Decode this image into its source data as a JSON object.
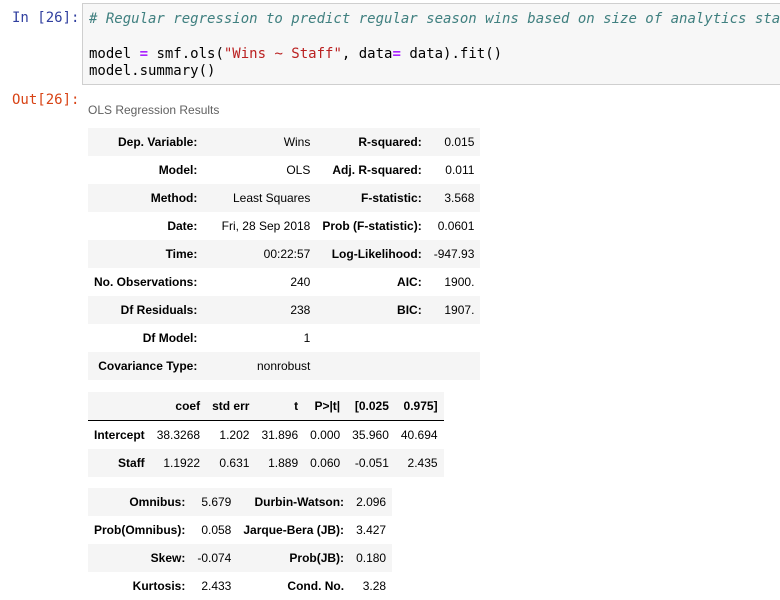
{
  "input_prompt": "In [26]:",
  "output_prompt": "Out[26]:",
  "code": {
    "line1": "# Regular regression to predict regular season wins based on size of analytics staff",
    "line2": [
      "model ",
      "=",
      " smf.ols(",
      "\"Wins ~ Staff\"",
      ", data",
      "=",
      " data).fit()"
    ],
    "line3": "model.summary()"
  },
  "caption": "OLS Regression Results",
  "summary_top": [
    [
      "Dep. Variable:",
      "Wins",
      "R-squared:",
      "0.015"
    ],
    [
      "Model:",
      "OLS",
      "Adj. R-squared:",
      "0.011"
    ],
    [
      "Method:",
      "Least Squares",
      "F-statistic:",
      "3.568"
    ],
    [
      "Date:",
      "Fri, 28 Sep 2018",
      "Prob (F-statistic):",
      "0.0601"
    ],
    [
      "Time:",
      "00:22:57",
      "Log-Likelihood:",
      "-947.93"
    ],
    [
      "No. Observations:",
      "240",
      "AIC:",
      "1900."
    ],
    [
      "Df Residuals:",
      "238",
      "BIC:",
      "1907."
    ],
    [
      "Df Model:",
      "1",
      "",
      ""
    ],
    [
      "Covariance Type:",
      "nonrobust",
      "",
      ""
    ]
  ],
  "coef_table": {
    "headers": [
      "",
      "coef",
      "std err",
      "t",
      "P>|t|",
      "[0.025",
      "0.975]"
    ],
    "rows": [
      [
        "Intercept",
        "38.3268",
        "1.202",
        "31.896",
        "0.000",
        "35.960",
        "40.694"
      ],
      [
        "Staff",
        "1.1922",
        "0.631",
        "1.889",
        "0.060",
        "-0.051",
        "2.435"
      ]
    ]
  },
  "diagnostics": [
    [
      "Omnibus:",
      "5.679",
      "Durbin-Watson:",
      "2.096"
    ],
    [
      "Prob(Omnibus):",
      "0.058",
      "Jarque-Bera (JB):",
      "3.427"
    ],
    [
      "Skew:",
      "-0.074",
      "Prob(JB):",
      "0.180"
    ],
    [
      "Kurtosis:",
      "2.433",
      "Cond. No.",
      "3.28"
    ]
  ]
}
